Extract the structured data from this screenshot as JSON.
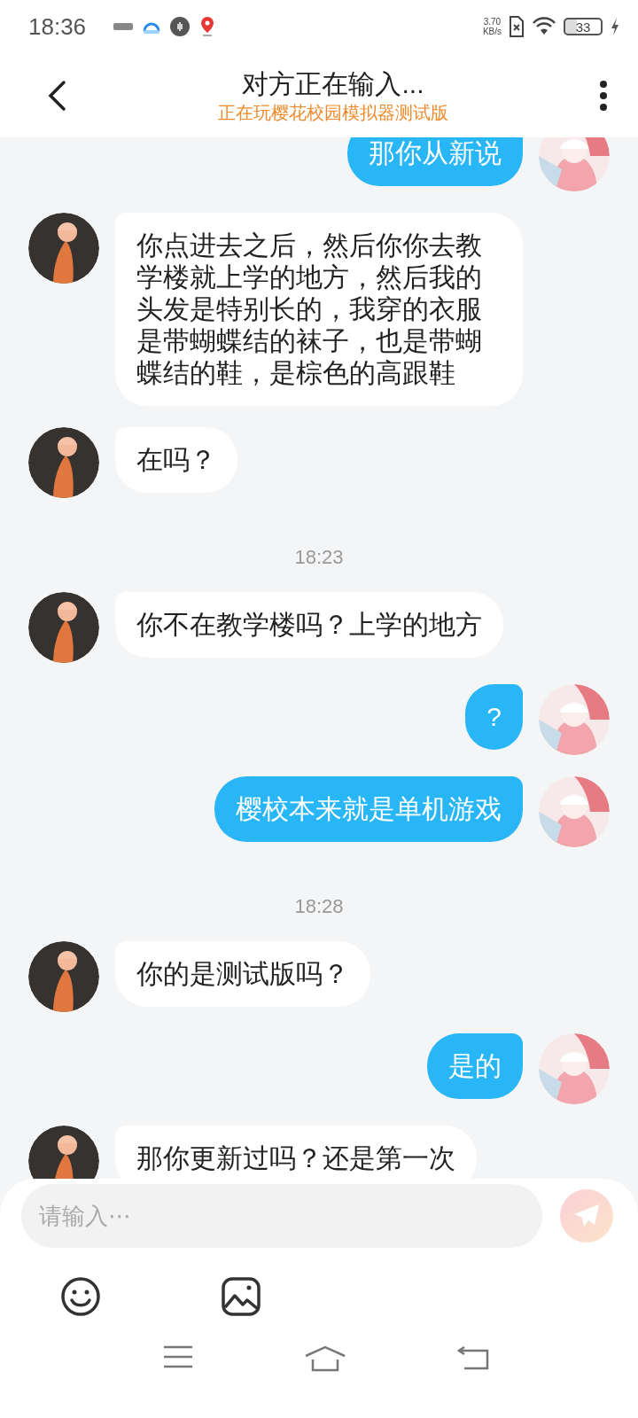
{
  "status_bar": {
    "time": "18:36",
    "net_speed_value": "3.70",
    "net_speed_unit": "KB/s",
    "battery": "33"
  },
  "header": {
    "title": "对方正在输入...",
    "subtitle": "正在玩樱花校园模拟器测试版"
  },
  "messages": [
    {
      "kind": "outgoing",
      "text": "那你从新说"
    },
    {
      "kind": "incoming",
      "text": "你点进去之后，然后你你去教学楼就上学的地方，然后我的头发是特别长的，我穿的衣服是带蝴蝶结的袜子，也是带蝴蝶结的鞋，是棕色的高跟鞋"
    },
    {
      "kind": "incoming",
      "text": "在吗？"
    },
    {
      "kind": "time",
      "text": "18:23"
    },
    {
      "kind": "incoming",
      "text": "你不在教学楼吗？上学的地方"
    },
    {
      "kind": "outgoing",
      "text": "?"
    },
    {
      "kind": "outgoing",
      "text": "樱校本来就是单机游戏"
    },
    {
      "kind": "time",
      "text": "18:28"
    },
    {
      "kind": "incoming",
      "text": "你的是测试版吗？"
    },
    {
      "kind": "outgoing",
      "text": "是的"
    },
    {
      "kind": "incoming",
      "text": "那你更新过吗？还是第一次"
    }
  ],
  "composer": {
    "placeholder": "请输入⋯",
    "send_disabled": true
  }
}
